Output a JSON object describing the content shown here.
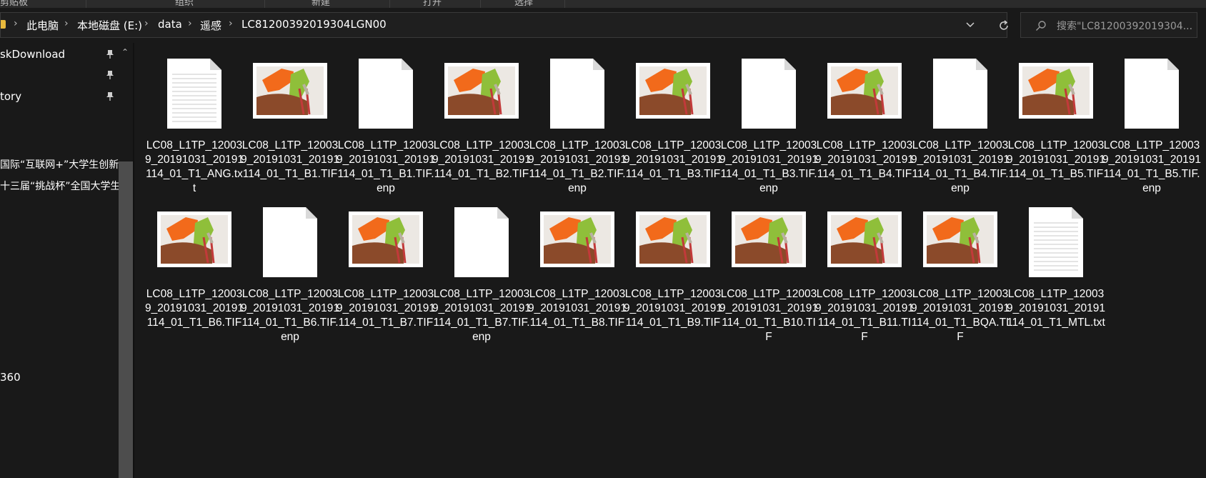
{
  "ribbon": {
    "items": [
      "剪贴板",
      "组织",
      "新建",
      "打开",
      "选择"
    ]
  },
  "address": {
    "breadcrumbs": [
      "此电脑",
      "本地磁盘 (E:)",
      "data",
      "遥感",
      "LC81200392019304LGN00"
    ]
  },
  "search": {
    "placeholder": "搜索\"LC81200392019304..."
  },
  "sidebar": {
    "items": [
      {
        "label": "skDownload",
        "pinned": true
      },
      {
        "label": "",
        "pinned": true
      },
      {
        "label": "tory",
        "pinned": true
      },
      {
        "label": "国际“互联网+”大学生创新",
        "pinned": false
      },
      {
        "label": "十三届“挑战杯”全国大学生",
        "pinned": false
      },
      {
        "label": "360",
        "pinned": false
      }
    ]
  },
  "files": [
    {
      "name": "LC08_L1TP_120039_20191031_20191114_01_T1_ANG.txt",
      "icon": "text-doc-icon"
    },
    {
      "name": "LC08_L1TP_120039_20191031_20191114_01_T1_B1.TIF",
      "icon": "image-icon"
    },
    {
      "name": "LC08_L1TP_120039_20191031_20191114_01_T1_B1.TIF.enp",
      "icon": "blank-doc-icon"
    },
    {
      "name": "LC08_L1TP_120039_20191031_20191114_01_T1_B2.TIF",
      "icon": "image-icon"
    },
    {
      "name": "LC08_L1TP_120039_20191031_20191114_01_T1_B2.TIF.enp",
      "icon": "blank-doc-icon"
    },
    {
      "name": "LC08_L1TP_120039_20191031_20191114_01_T1_B3.TIF",
      "icon": "image-icon"
    },
    {
      "name": "LC08_L1TP_120039_20191031_20191114_01_T1_B3.TIF.enp",
      "icon": "blank-doc-icon"
    },
    {
      "name": "LC08_L1TP_120039_20191031_20191114_01_T1_B4.TIF",
      "icon": "image-icon"
    },
    {
      "name": "LC08_L1TP_120039_20191031_20191114_01_T1_B4.TIF.enp",
      "icon": "blank-doc-icon"
    },
    {
      "name": "LC08_L1TP_120039_20191031_20191114_01_T1_B5.TIF",
      "icon": "image-icon"
    },
    {
      "name": "LC08_L1TP_120039_20191031_20191114_01_T1_B5.TIF.enp",
      "icon": "blank-doc-icon"
    },
    {
      "name": "LC08_L1TP_120039_20191031_20191114_01_T1_B6.TIF",
      "icon": "image-icon"
    },
    {
      "name": "LC08_L1TP_120039_20191031_20191114_01_T1_B6.TIF.enp",
      "icon": "blank-doc-icon"
    },
    {
      "name": "LC08_L1TP_120039_20191031_20191114_01_T1_B7.TIF",
      "icon": "image-icon"
    },
    {
      "name": "LC08_L1TP_120039_20191031_20191114_01_T1_B7.TIF.enp",
      "icon": "blank-doc-icon"
    },
    {
      "name": "LC08_L1TP_120039_20191031_20191114_01_T1_B8.TIF",
      "icon": "image-icon"
    },
    {
      "name": "LC08_L1TP_120039_20191031_20191114_01_T1_B9.TIF",
      "icon": "image-icon"
    },
    {
      "name": "LC08_L1TP_120039_20191031_20191114_01_T1_B10.TIF",
      "icon": "image-icon"
    },
    {
      "name": "LC08_L1TP_120039_20191031_20191114_01_T1_B11.TIF",
      "icon": "image-icon"
    },
    {
      "name": "LC08_L1TP_120039_20191031_20191114_01_T1_BQA.TIF",
      "icon": "image-icon"
    },
    {
      "name": "LC08_L1TP_120039_20191031_20191114_01_T1_MTL.txt",
      "icon": "text-doc-icon"
    }
  ],
  "colors": {
    "background": "#191919",
    "folder": "#e8b93c",
    "paint": "#f26a1b",
    "leaf": "#8fbf3a",
    "wood": "#8b4a2a"
  }
}
